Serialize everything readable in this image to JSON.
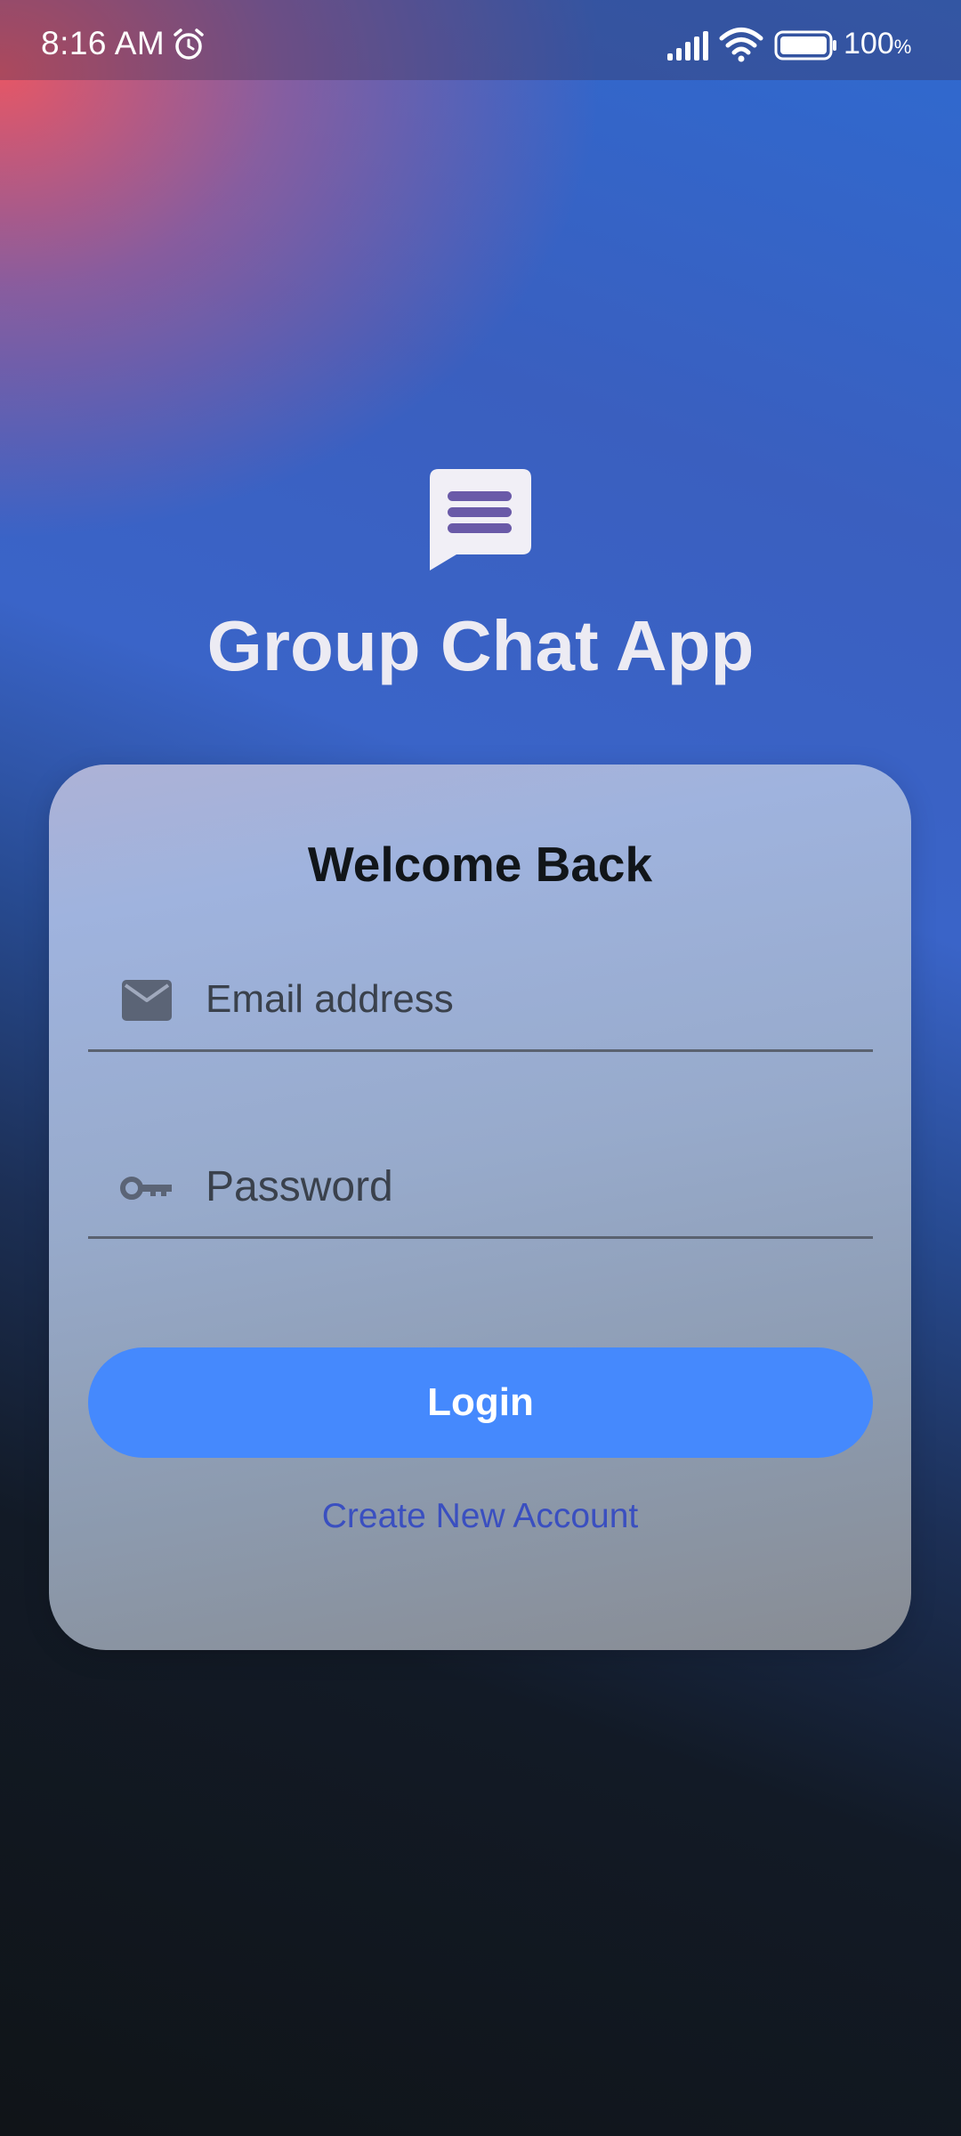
{
  "status_bar": {
    "time": "8:16 AM",
    "battery_level": "100",
    "battery_unit": "%",
    "icons": [
      "alarm-icon",
      "signal-icon",
      "wifi-icon",
      "battery-icon"
    ]
  },
  "header": {
    "logo_icon": "chat-bubble-icon",
    "app_title": "Group Chat App"
  },
  "login_card": {
    "title": "Welcome Back",
    "email": {
      "icon": "mail-icon",
      "placeholder": "Email address",
      "value": ""
    },
    "password": {
      "icon": "key-icon",
      "placeholder": "Password",
      "value": ""
    },
    "login_label": "Login",
    "create_account_label": "Create New Account"
  },
  "colors": {
    "primary_button": "#4589fd",
    "link": "#3a4fc0",
    "title_text": "#ecebf3"
  }
}
